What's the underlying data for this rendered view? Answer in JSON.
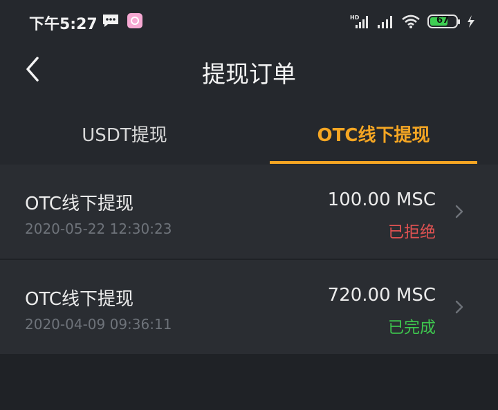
{
  "status_bar": {
    "time": "下午5:27",
    "battery": "67"
  },
  "nav": {
    "title": "提现订单"
  },
  "tabs": [
    {
      "label": "USDT提现",
      "active": false
    },
    {
      "label": "OTC线下提现",
      "active": true
    }
  ],
  "orders": [
    {
      "title": "OTC线下提现",
      "date": "2020-05-22 12:30:23",
      "amount": "100.00 MSC",
      "status": "已拒绝",
      "status_color": "#e05252"
    },
    {
      "title": "OTC线下提现",
      "date": "2020-04-09 09:36:11",
      "amount": "720.00 MSC",
      "status": "已完成",
      "status_color": "#3ec74e"
    }
  ],
  "colors": {
    "accent": "#f5a623",
    "background": "#1f2226",
    "card": "#2a2d32"
  }
}
